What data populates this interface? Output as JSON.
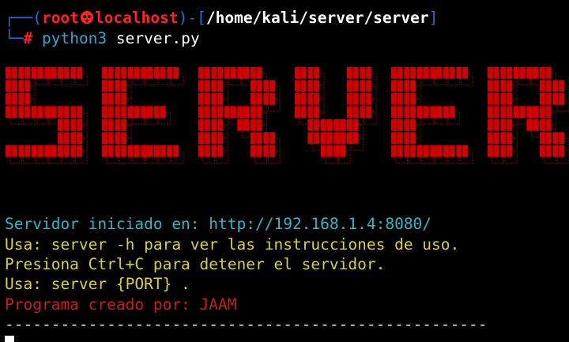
{
  "prompt": {
    "tree_top": "┌──(",
    "user": "root",
    "host": "localhost",
    "close_paren": ")",
    "dash": "-",
    "path_open": "[",
    "path": "/home/kali/server/server",
    "path_close": "]",
    "tree_bottom": "└─",
    "hash": "#",
    "command_bin": "python3",
    "command_arg": "server.py"
  },
  "banner": {
    "text": "SERVER",
    "color": "#d40000",
    "shadow_color": "#6a0a0a"
  },
  "output": {
    "line1": "Servidor iniciado en: http://192.168.1.4:8080/",
    "line2": "Usa: server -h para ver las instrucciones de uso.",
    "line3": "Presiona Ctrl+C para detener el servidor.",
    "line4": "Usa: server {PORT} .",
    "line5": "Programa creado por: JAAM",
    "line6": "----------------------------------------------------"
  },
  "colors": {
    "background": "#000000",
    "prompt_blue": "#2f6bd8",
    "prompt_red": "#ff2222",
    "cyan": "#2fb6c8",
    "yellow": "#d8d23a",
    "red": "#c81e1e"
  }
}
